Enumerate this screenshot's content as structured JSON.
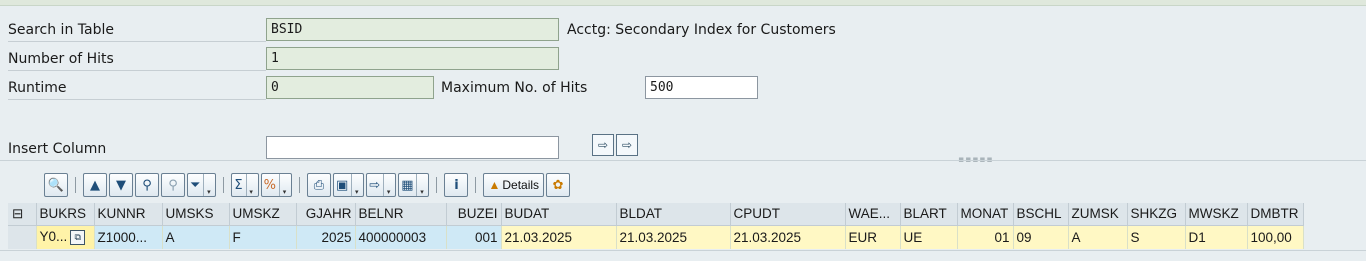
{
  "form": {
    "search_in_table_label": "Search in Table",
    "search_in_table_value": "BSID",
    "table_description": "Acctg: Secondary Index for Customers",
    "number_of_hits_label": "Number of Hits",
    "number_of_hits_value": "1",
    "runtime_label": "Runtime",
    "runtime_value": "0",
    "max_hits_label": "Maximum No. of Hits",
    "max_hits_value": "500",
    "insert_column_label": "Insert Column",
    "insert_column_value": ""
  },
  "toolbar": {
    "details_label": "Details",
    "buttons": [
      "details-view-icon",
      "sort-ascending-icon",
      "sort-descending-icon",
      "find-icon",
      "find-next-icon",
      "filter-icon",
      "sum-icon",
      "subtotal-icon",
      "print-icon",
      "views-icon",
      "export-icon",
      "layout-icon",
      "info-icon",
      "details-icon",
      "favorite-icon"
    ]
  },
  "table": {
    "columns": [
      "BUKRS",
      "KUNNR",
      "UMSKS",
      "UMSKZ",
      "GJAHR",
      "BELNR",
      "BUZEI",
      "BUDAT",
      "BLDAT",
      "CPUDT",
      "WAE...",
      "BLART",
      "MONAT",
      "BSCHL",
      "ZUMSK",
      "SHKZG",
      "MWSKZ",
      "DMBTR"
    ],
    "rows": [
      [
        "Y0...",
        "Z1000...",
        "A",
        "F",
        "2025",
        "400000003",
        "001",
        "21.03.2025",
        "21.03.2025",
        "21.03.2025",
        "EUR",
        "UE",
        "01",
        "09",
        "A",
        "S",
        "D1",
        "100,00"
      ]
    ]
  },
  "colors": {
    "background": "#e8eef1",
    "display_field": "#e3eddf",
    "key_cell": "#cfe9f6",
    "data_cell": "#fff8c4",
    "focus_marker": "#cc2a2a"
  }
}
